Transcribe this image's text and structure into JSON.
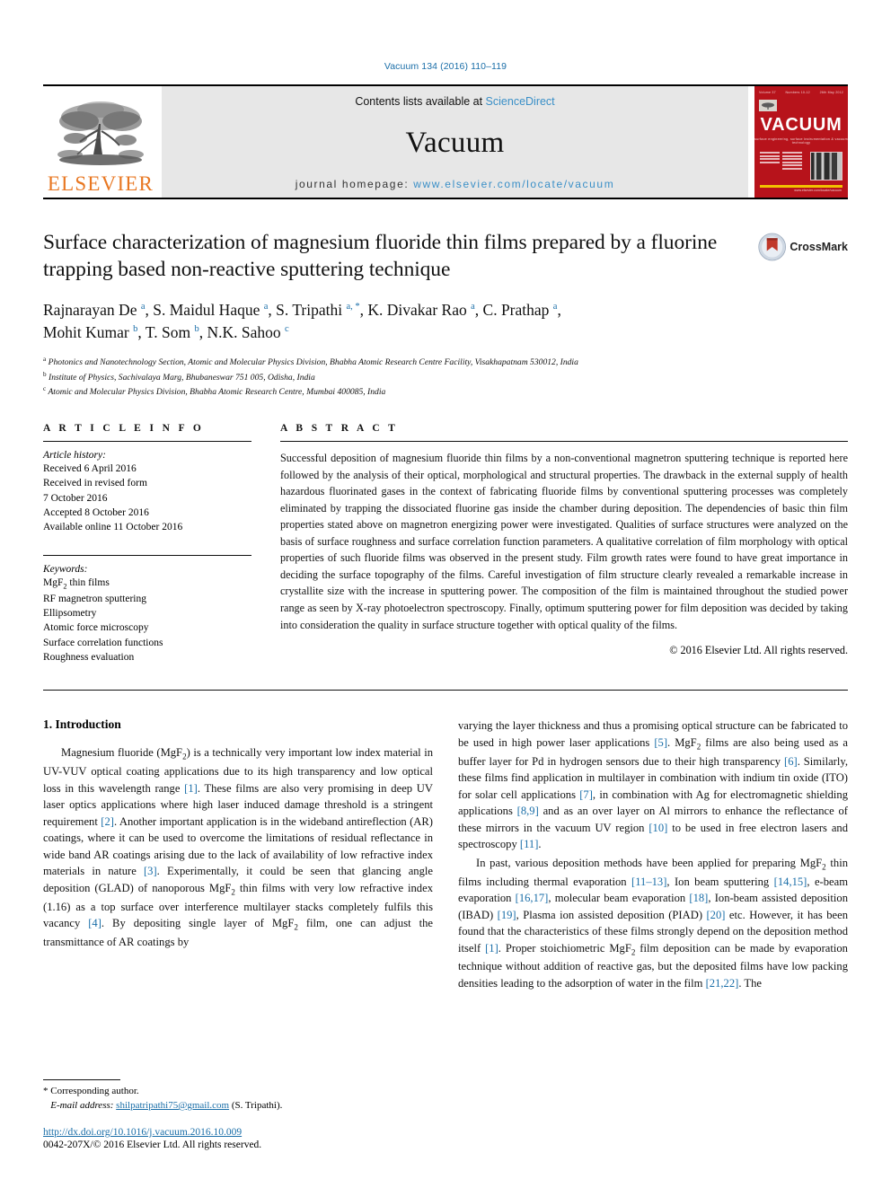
{
  "running_head": "Vacuum 134 (2016) 110–119",
  "masthead": {
    "publisher": "ELSEVIER",
    "contents_prefix": "Contents lists available at ",
    "contents_link": "ScienceDirect",
    "journal_name": "Vacuum",
    "homepage_prefix": "journal homepage: ",
    "homepage_url": "www.elsevier.com/locate/vacuum",
    "cover": {
      "title": "VACUUM",
      "subtitle": "surface engineering, surface instrumentation & vacuum technology",
      "top_left": "Volume 37",
      "top_mid": "Numbers 10-12",
      "top_right": "26th May 2012",
      "footer": "www.elsevier.com/locate/vacuum"
    }
  },
  "title": "Surface characterization of magnesium fluoride thin films prepared by a fluorine trapping based non-reactive sputtering technique",
  "crossmark_label": "CrossMark",
  "authors": [
    {
      "name": "Rajnarayan De",
      "marks": "a"
    },
    {
      "name": "S. Maidul Haque",
      "marks": "a"
    },
    {
      "name": "S. Tripathi",
      "marks": "a, *"
    },
    {
      "name": "K. Divakar Rao",
      "marks": "a"
    },
    {
      "name": "C. Prathap",
      "marks": "a"
    },
    {
      "name": "Mohit Kumar",
      "marks": "b"
    },
    {
      "name": "T. Som",
      "marks": "b"
    },
    {
      "name": "N.K. Sahoo",
      "marks": "c"
    }
  ],
  "affiliations": [
    {
      "mark": "a",
      "text": "Photonics and Nanotechnology Section, Atomic and Molecular Physics Division, Bhabha Atomic Research Centre Facility, Visakhapatnam 530012, India"
    },
    {
      "mark": "b",
      "text": "Institute of Physics, Sachivalaya Marg, Bhubaneswar 751 005, Odisha, India"
    },
    {
      "mark": "c",
      "text": "Atomic and Molecular Physics Division, Bhabha Atomic Research Centre, Mumbai 400085, India"
    }
  ],
  "article_info": {
    "heading": "A R T I C L E  I N F O",
    "history_label": "Article history:",
    "history": [
      "Received 6 April 2016",
      "Received in revised form",
      "7 October 2016",
      "Accepted 8 October 2016",
      "Available online 11 October 2016"
    ],
    "keywords_label": "Keywords:",
    "keywords": [
      "MgF2 thin films",
      "RF magnetron sputtering",
      "Ellipsometry",
      "Atomic force microscopy",
      "Surface correlation functions",
      "Roughness evaluation"
    ]
  },
  "abstract": {
    "heading": "A B S T R A C T",
    "text": "Successful deposition of magnesium fluoride thin films by a non-conventional magnetron sputtering technique is reported here followed by the analysis of their optical, morphological and structural properties. The drawback in the external supply of health hazardous fluorinated gases in the context of fabricating fluoride films by conventional sputtering processes was completely eliminated by trapping the dissociated fluorine gas inside the chamber during deposition. The dependencies of basic thin film properties stated above on magnetron energizing power were investigated. Qualities of surface structures were analyzed on the basis of surface roughness and surface correlation function parameters. A qualitative correlation of film morphology with optical properties of such fluoride films was observed in the present study. Film growth rates were found to have great importance in deciding the surface topography of the films. Careful investigation of film structure clearly revealed a remarkable increase in crystallite size with the increase in sputtering power. The composition of the film is maintained throughout the studied power range as seen by X-ray photoelectron spectroscopy. Finally, optimum sputtering power for film deposition was decided by taking into consideration the quality in surface structure together with optical quality of the films.",
    "copyright": "© 2016 Elsevier Ltd. All rights reserved."
  },
  "body": {
    "section_title": "1. Introduction",
    "left_paragraphs": [
      "Magnesium fluoride (MgF2) is a technically very important low index material in UV-VUV optical coating applications due to its high transparency and low optical loss in this wavelength range [1]. These films are also very promising in deep UV laser optics applications where high laser induced damage threshold is a stringent requirement [2]. Another important application is in the wideband antireflection (AR) coatings, where it can be used to overcome the limitations of residual reflectance in wide band AR coatings arising due to the lack of availability of low refractive index materials in nature [3]. Experimentally, it could be seen that glancing angle deposition (GLAD) of nanoporous MgF2 thin films with very low refractive index (1.16) as a top surface over interference multilayer stacks completely fulfils this vacancy [4]. By depositing single layer of MgF2 film, one can adjust the transmittance of AR coatings by"
    ],
    "right_paragraphs": [
      "varying the layer thickness and thus a promising optical structure can be fabricated to be used in high power laser applications [5]. MgF2 films are also being used as a buffer layer for Pd in hydrogen sensors due to their high transparency [6]. Similarly, these films find application in multilayer in combination with indium tin oxide (ITO) for solar cell applications [7], in combination with Ag for electromagnetic shielding applications [8,9] and as an over layer on Al mirrors to enhance the reflectance of these mirrors in the vacuum UV region [10] to be used in free electron lasers and spectroscopy [11].",
      "In past, various deposition methods have been applied for preparing MgF2 thin films including thermal evaporation [11–13], Ion beam sputtering [14,15], e-beam evaporation [16,17], molecular beam evaporation [18], Ion-beam assisted deposition (IBAD) [19], Plasma ion assisted deposition (PIAD) [20] etc. However, it has been found that the characteristics of these films strongly depend on the deposition method itself [1]. Proper stoichiometric MgF2 film deposition can be made by evaporation technique without addition of reactive gas, but the deposited films have low packing densities leading to the adsorption of water in the film [21,22]. The"
    ]
  },
  "footnotes": {
    "corresponding": "* Corresponding author.",
    "email_label": "E-mail address:",
    "email": "shilpatripathi75@gmail.com",
    "email_suffix": "(S. Tripathi).",
    "doi": "http://dx.doi.org/10.1016/j.vacuum.2016.10.009",
    "issn": "0042-207X/© 2016 Elsevier Ltd. All rights reserved."
  }
}
